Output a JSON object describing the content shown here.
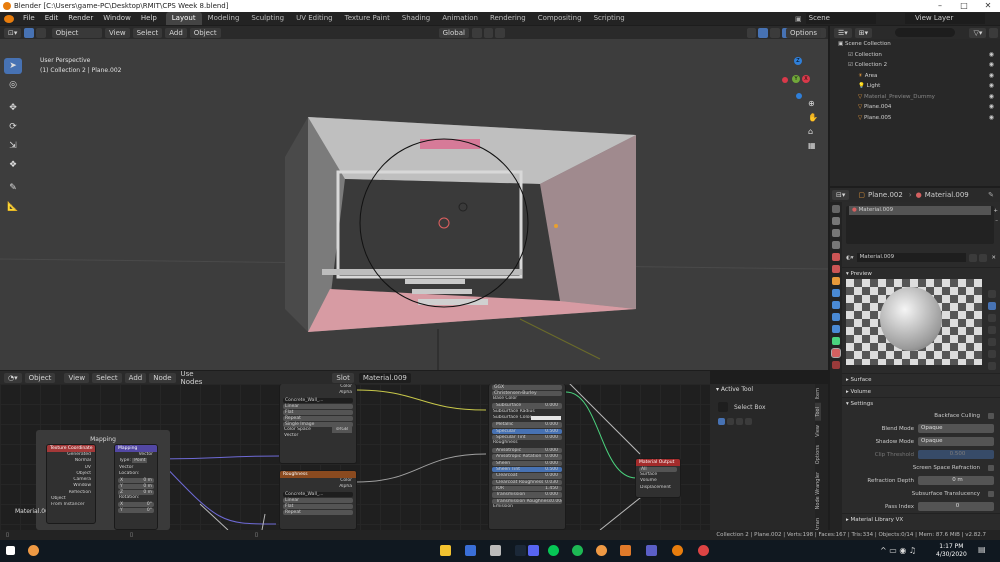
{
  "window": {
    "title": "Blender [C:\\Users\\game-PC\\Desktop\\RMIT\\CPS Week 8.blend]"
  },
  "menu": [
    "File",
    "Edit",
    "Render",
    "Window",
    "Help"
  ],
  "workspaces": [
    "Layout",
    "Modeling",
    "Sculpting",
    "UV Editing",
    "Texture Paint",
    "Shading",
    "Animation",
    "Rendering",
    "Compositing",
    "Scripting"
  ],
  "active_workspace": "Layout",
  "scene_label": "Scene",
  "view_layer_label": "View Layer",
  "viewport": {
    "mode": "Object Mode",
    "menus": [
      "View",
      "Select",
      "Add",
      "Object"
    ],
    "transform": "Global",
    "options": "Options",
    "perspective": "User Perspective",
    "collection_info": "(1) Collection 2 | Plane.002",
    "gizmo": {
      "x": "X",
      "y": "Y",
      "z": "Z"
    }
  },
  "node_editor": {
    "editor": "Object",
    "menus": [
      "View",
      "Select",
      "Add",
      "Node"
    ],
    "use_nodes": "Use Nodes",
    "slot": "Slot 1",
    "material": "Material.009",
    "frame_label": "Mapping",
    "corner_label": "Material.009",
    "texcoord": {
      "title": "Texture Coordinate",
      "rows": [
        "Generated",
        "Normal",
        "UV",
        "Object",
        "Camera",
        "Window",
        "Reflection"
      ],
      "object_label": "Object",
      "from_instancer": "From Instancer"
    },
    "mapping": {
      "title": "Mapping",
      "out": "Vector",
      "type_label": "Type:",
      "type_val": "Point",
      "vector": "Vector",
      "location": "Location:",
      "x": "X",
      "y": "Y",
      "z": "Z",
      "loc": [
        "0 m",
        "0 m",
        "0 m"
      ],
      "rotation": "Rotation:",
      "rot": [
        "0°",
        "0°"
      ]
    },
    "tex1": {
      "out": [
        "Color",
        "Alpha"
      ],
      "image": "Concrete_Wall_...",
      "opts": [
        "Linear",
        "Flat",
        "Repeat",
        "Single Image"
      ],
      "cs_label": "Color Space",
      "cs_val": "sRGB",
      "vector": "Vector"
    },
    "tex2": {
      "title": "Roughness",
      "out": [
        "Color",
        "Alpha"
      ],
      "image": "Concrete_Wall_...",
      "opts": [
        "Linear",
        "Flat",
        "Repeat"
      ]
    },
    "bsdf": {
      "out": "BSDF",
      "dist": "GGX",
      "ss": "Christensen-Burley",
      "rows": [
        [
          "Base Color",
          ""
        ],
        [
          "Subsurface",
          "0.000"
        ],
        [
          "Subsurface Radius",
          ""
        ],
        [
          "Subsurface Color",
          ""
        ],
        [
          "Metallic",
          "0.000"
        ],
        [
          "Specular",
          "0.500"
        ],
        [
          "Specular Tint",
          "0.000"
        ],
        [
          "Roughness",
          ""
        ],
        [
          "Anisotropic",
          "0.000"
        ],
        [
          "Anisotropic Rotation",
          "0.000"
        ],
        [
          "Sheen",
          "0.000"
        ],
        [
          "Sheen Tint",
          "0.500"
        ],
        [
          "Clearcoat",
          "0.000"
        ],
        [
          "Clearcoat Roughness",
          "0.030"
        ],
        [
          "IOR",
          "1.450"
        ],
        [
          "Transmission",
          "0.000"
        ],
        [
          "Transmission Roughness",
          "0.000"
        ],
        [
          "Emission",
          ""
        ]
      ]
    },
    "output": {
      "title": "Material Output",
      "target": "All",
      "rows": [
        "Surface",
        "Volume",
        "Displacement"
      ]
    }
  },
  "active_tool": {
    "title": "Active Tool",
    "tool": "Select Box"
  },
  "sidebar_tabs": [
    "Item",
    "Tool",
    "View",
    "Options",
    "Node Wrangler",
    "Arran"
  ],
  "outliner": {
    "rows": [
      {
        "name": "Scene Collection",
        "indent": 0
      },
      {
        "name": "Collection",
        "indent": 1
      },
      {
        "name": "Collection 2",
        "indent": 1
      },
      {
        "name": "Area",
        "indent": 2
      },
      {
        "name": "Light",
        "indent": 2
      },
      {
        "name": "Material_Preview_Dummy",
        "indent": 2
      },
      {
        "name": "Plane.004",
        "indent": 2
      },
      {
        "name": "Plane.005",
        "indent": 2
      }
    ]
  },
  "properties": {
    "object": "Plane.002",
    "material_crumb": "Material.009",
    "slot_item": "Material.009",
    "material": "Material.009",
    "sections": {
      "preview": "Preview",
      "surface": "Surface",
      "volume": "Volume",
      "settings": "Settings",
      "library": "Material Library VX"
    },
    "backface": "Backface Culling",
    "blend_label": "Blend Mode",
    "blend_val": "Opaque",
    "shadow_label": "Shadow Mode",
    "shadow_val": "Opaque",
    "clip_label": "Clip Threshold",
    "clip_val": "0.500",
    "ssr": "Screen Space Refraction",
    "refr_label": "Refraction Depth",
    "refr_val": "0 m",
    "sst": "Subsurface Translucency",
    "pass_label": "Pass Index",
    "pass_val": "0"
  },
  "status": "Collection 2 | Plane.002 | Verts:198 | Faces:167 | Tris:334 | Objects:0/14 | Mem: 87.6 MiB | v2.82.7",
  "taskbar": {
    "time": "1:17 PM",
    "date": "4/30/2020"
  },
  "colors": {
    "accent": "#4772b3",
    "node_tex": "#8a4a1f",
    "node_shader": "#2f7a4e",
    "node_output": "#a32b2b",
    "node_vector": "#5247a3",
    "node_input": "#a33838"
  }
}
